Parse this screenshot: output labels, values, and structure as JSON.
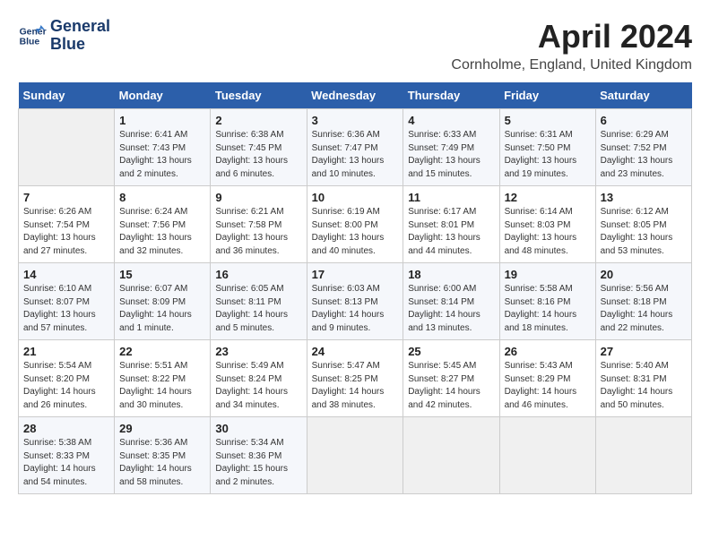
{
  "logo": {
    "line1": "General",
    "line2": "Blue"
  },
  "title": "April 2024",
  "location": "Cornholme, England, United Kingdom",
  "days_of_week": [
    "Sunday",
    "Monday",
    "Tuesday",
    "Wednesday",
    "Thursday",
    "Friday",
    "Saturday"
  ],
  "weeks": [
    [
      {
        "day": "",
        "sunrise": "",
        "sunset": "",
        "daylight": ""
      },
      {
        "day": "1",
        "sunrise": "Sunrise: 6:41 AM",
        "sunset": "Sunset: 7:43 PM",
        "daylight": "Daylight: 13 hours and 2 minutes."
      },
      {
        "day": "2",
        "sunrise": "Sunrise: 6:38 AM",
        "sunset": "Sunset: 7:45 PM",
        "daylight": "Daylight: 13 hours and 6 minutes."
      },
      {
        "day": "3",
        "sunrise": "Sunrise: 6:36 AM",
        "sunset": "Sunset: 7:47 PM",
        "daylight": "Daylight: 13 hours and 10 minutes."
      },
      {
        "day": "4",
        "sunrise": "Sunrise: 6:33 AM",
        "sunset": "Sunset: 7:49 PM",
        "daylight": "Daylight: 13 hours and 15 minutes."
      },
      {
        "day": "5",
        "sunrise": "Sunrise: 6:31 AM",
        "sunset": "Sunset: 7:50 PM",
        "daylight": "Daylight: 13 hours and 19 minutes."
      },
      {
        "day": "6",
        "sunrise": "Sunrise: 6:29 AM",
        "sunset": "Sunset: 7:52 PM",
        "daylight": "Daylight: 13 hours and 23 minutes."
      }
    ],
    [
      {
        "day": "7",
        "sunrise": "Sunrise: 6:26 AM",
        "sunset": "Sunset: 7:54 PM",
        "daylight": "Daylight: 13 hours and 27 minutes."
      },
      {
        "day": "8",
        "sunrise": "Sunrise: 6:24 AM",
        "sunset": "Sunset: 7:56 PM",
        "daylight": "Daylight: 13 hours and 32 minutes."
      },
      {
        "day": "9",
        "sunrise": "Sunrise: 6:21 AM",
        "sunset": "Sunset: 7:58 PM",
        "daylight": "Daylight: 13 hours and 36 minutes."
      },
      {
        "day": "10",
        "sunrise": "Sunrise: 6:19 AM",
        "sunset": "Sunset: 8:00 PM",
        "daylight": "Daylight: 13 hours and 40 minutes."
      },
      {
        "day": "11",
        "sunrise": "Sunrise: 6:17 AM",
        "sunset": "Sunset: 8:01 PM",
        "daylight": "Daylight: 13 hours and 44 minutes."
      },
      {
        "day": "12",
        "sunrise": "Sunrise: 6:14 AM",
        "sunset": "Sunset: 8:03 PM",
        "daylight": "Daylight: 13 hours and 48 minutes."
      },
      {
        "day": "13",
        "sunrise": "Sunrise: 6:12 AM",
        "sunset": "Sunset: 8:05 PM",
        "daylight": "Daylight: 13 hours and 53 minutes."
      }
    ],
    [
      {
        "day": "14",
        "sunrise": "Sunrise: 6:10 AM",
        "sunset": "Sunset: 8:07 PM",
        "daylight": "Daylight: 13 hours and 57 minutes."
      },
      {
        "day": "15",
        "sunrise": "Sunrise: 6:07 AM",
        "sunset": "Sunset: 8:09 PM",
        "daylight": "Daylight: 14 hours and 1 minute."
      },
      {
        "day": "16",
        "sunrise": "Sunrise: 6:05 AM",
        "sunset": "Sunset: 8:11 PM",
        "daylight": "Daylight: 14 hours and 5 minutes."
      },
      {
        "day": "17",
        "sunrise": "Sunrise: 6:03 AM",
        "sunset": "Sunset: 8:13 PM",
        "daylight": "Daylight: 14 hours and 9 minutes."
      },
      {
        "day": "18",
        "sunrise": "Sunrise: 6:00 AM",
        "sunset": "Sunset: 8:14 PM",
        "daylight": "Daylight: 14 hours and 13 minutes."
      },
      {
        "day": "19",
        "sunrise": "Sunrise: 5:58 AM",
        "sunset": "Sunset: 8:16 PM",
        "daylight": "Daylight: 14 hours and 18 minutes."
      },
      {
        "day": "20",
        "sunrise": "Sunrise: 5:56 AM",
        "sunset": "Sunset: 8:18 PM",
        "daylight": "Daylight: 14 hours and 22 minutes."
      }
    ],
    [
      {
        "day": "21",
        "sunrise": "Sunrise: 5:54 AM",
        "sunset": "Sunset: 8:20 PM",
        "daylight": "Daylight: 14 hours and 26 minutes."
      },
      {
        "day": "22",
        "sunrise": "Sunrise: 5:51 AM",
        "sunset": "Sunset: 8:22 PM",
        "daylight": "Daylight: 14 hours and 30 minutes."
      },
      {
        "day": "23",
        "sunrise": "Sunrise: 5:49 AM",
        "sunset": "Sunset: 8:24 PM",
        "daylight": "Daylight: 14 hours and 34 minutes."
      },
      {
        "day": "24",
        "sunrise": "Sunrise: 5:47 AM",
        "sunset": "Sunset: 8:25 PM",
        "daylight": "Daylight: 14 hours and 38 minutes."
      },
      {
        "day": "25",
        "sunrise": "Sunrise: 5:45 AM",
        "sunset": "Sunset: 8:27 PM",
        "daylight": "Daylight: 14 hours and 42 minutes."
      },
      {
        "day": "26",
        "sunrise": "Sunrise: 5:43 AM",
        "sunset": "Sunset: 8:29 PM",
        "daylight": "Daylight: 14 hours and 46 minutes."
      },
      {
        "day": "27",
        "sunrise": "Sunrise: 5:40 AM",
        "sunset": "Sunset: 8:31 PM",
        "daylight": "Daylight: 14 hours and 50 minutes."
      }
    ],
    [
      {
        "day": "28",
        "sunrise": "Sunrise: 5:38 AM",
        "sunset": "Sunset: 8:33 PM",
        "daylight": "Daylight: 14 hours and 54 minutes."
      },
      {
        "day": "29",
        "sunrise": "Sunrise: 5:36 AM",
        "sunset": "Sunset: 8:35 PM",
        "daylight": "Daylight: 14 hours and 58 minutes."
      },
      {
        "day": "30",
        "sunrise": "Sunrise: 5:34 AM",
        "sunset": "Sunset: 8:36 PM",
        "daylight": "Daylight: 15 hours and 2 minutes."
      },
      {
        "day": "",
        "sunrise": "",
        "sunset": "",
        "daylight": ""
      },
      {
        "day": "",
        "sunrise": "",
        "sunset": "",
        "daylight": ""
      },
      {
        "day": "",
        "sunrise": "",
        "sunset": "",
        "daylight": ""
      },
      {
        "day": "",
        "sunrise": "",
        "sunset": "",
        "daylight": ""
      }
    ]
  ]
}
